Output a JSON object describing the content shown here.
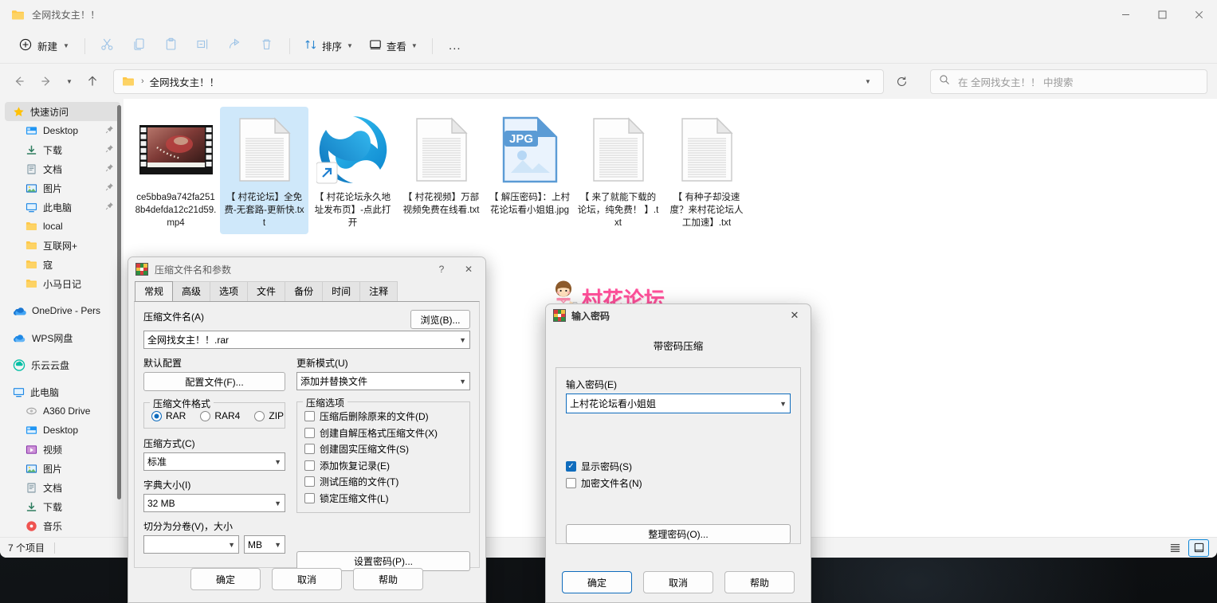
{
  "window": {
    "title": "全网找女主！！",
    "minimize_label": "最小化",
    "maximize_label": "最大化",
    "close_label": "关闭"
  },
  "toolbar": {
    "new_label": "新建",
    "cut_label": "剪切",
    "copy_label": "复制",
    "paste_label": "粘贴",
    "rename_label": "重命名",
    "share_label": "共享",
    "delete_label": "删除",
    "sort_label": "排序",
    "view_label": "查看",
    "more_label": "..."
  },
  "address": {
    "back_label": "后退",
    "forward_label": "前进",
    "recent_label": "最近位置",
    "up_label": "向上",
    "crumb_separator": "›",
    "crumb_text": "全网找女主！！",
    "refresh_label": "刷新"
  },
  "search": {
    "placeholder": "在 全网找女主！！ 中搜索"
  },
  "sidebar": {
    "items": [
      {
        "label": "快速访问",
        "icon": "star-icon",
        "selected": true,
        "indent": false,
        "pinned": false,
        "gap": false
      },
      {
        "label": "Desktop",
        "icon": "desktop-icon",
        "selected": false,
        "indent": true,
        "pinned": true,
        "gap": false
      },
      {
        "label": "下载",
        "icon": "download-icon",
        "selected": false,
        "indent": true,
        "pinned": true,
        "gap": false
      },
      {
        "label": "文档",
        "icon": "document-icon",
        "selected": false,
        "indent": true,
        "pinned": true,
        "gap": false
      },
      {
        "label": "图片",
        "icon": "picture-icon",
        "selected": false,
        "indent": true,
        "pinned": true,
        "gap": false
      },
      {
        "label": "此电脑",
        "icon": "computer-icon",
        "selected": false,
        "indent": true,
        "pinned": true,
        "gap": false
      },
      {
        "label": "local",
        "icon": "folder-icon",
        "selected": false,
        "indent": true,
        "pinned": false,
        "gap": false
      },
      {
        "label": "互联网+",
        "icon": "folder-icon",
        "selected": false,
        "indent": true,
        "pinned": false,
        "gap": false
      },
      {
        "label": "寇",
        "icon": "folder-icon",
        "selected": false,
        "indent": true,
        "pinned": false,
        "gap": false
      },
      {
        "label": "小马日记",
        "icon": "folder-icon",
        "selected": false,
        "indent": true,
        "pinned": false,
        "gap": false
      },
      {
        "label": "OneDrive - Pers",
        "icon": "onedrive-icon",
        "selected": false,
        "indent": false,
        "pinned": false,
        "gap": true
      },
      {
        "label": "WPS网盘",
        "icon": "wps-cloud-icon",
        "selected": false,
        "indent": false,
        "pinned": false,
        "gap": true
      },
      {
        "label": "乐云云盘",
        "icon": "cloud-icon",
        "selected": false,
        "indent": false,
        "pinned": false,
        "gap": true
      },
      {
        "label": "此电脑",
        "icon": "computer-icon",
        "selected": false,
        "indent": false,
        "pinned": false,
        "gap": true
      },
      {
        "label": "A360 Drive",
        "icon": "a360-icon",
        "selected": false,
        "indent": true,
        "pinned": false,
        "gap": false
      },
      {
        "label": "Desktop",
        "icon": "desktop-icon",
        "selected": false,
        "indent": true,
        "pinned": false,
        "gap": false
      },
      {
        "label": "视频",
        "icon": "video-icon",
        "selected": false,
        "indent": true,
        "pinned": false,
        "gap": false
      },
      {
        "label": "图片",
        "icon": "picture-icon",
        "selected": false,
        "indent": true,
        "pinned": false,
        "gap": false
      },
      {
        "label": "文档",
        "icon": "document-icon",
        "selected": false,
        "indent": true,
        "pinned": false,
        "gap": false
      },
      {
        "label": "下载",
        "icon": "download-icon",
        "selected": false,
        "indent": true,
        "pinned": false,
        "gap": false
      },
      {
        "label": "音乐",
        "icon": "music-icon",
        "selected": false,
        "indent": true,
        "pinned": false,
        "gap": false
      }
    ]
  },
  "files": [
    {
      "name": "ce5bba9a742fa2518b4defda12c21d59.mp4",
      "type": "video-thumb",
      "selected": false
    },
    {
      "name": "【 村花论坛】全免费-无套路-更新快.txt",
      "type": "text-file",
      "selected": true
    },
    {
      "name": "【 村花论坛永久地址发布页】-点此打开",
      "type": "edge-shortcut",
      "selected": false
    },
    {
      "name": "【 村花视频】万部视频免费在线看.txt",
      "type": "text-file",
      "selected": false
    },
    {
      "name": "【 解压密码】：上村花论坛看小姐姐.jpg",
      "type": "jpg-file",
      "selected": false
    },
    {
      "name": "【 来了就能下载的论坛，纯免费！ 】.txt",
      "type": "text-file",
      "selected": false
    },
    {
      "name": "【 有种子却没速度？来村花论坛人工加速】.txt",
      "type": "text-file",
      "selected": false
    }
  ],
  "statusbar": {
    "item_count": "7 个项目",
    "list_view_label": "详细列表",
    "large_icons_label": "大图标"
  },
  "watermark": {
    "text": "村花论坛"
  },
  "rar_dialog": {
    "title": "压缩文件名和参数",
    "help_label": "?",
    "close_label": "✕",
    "tabs": [
      {
        "label": "常规",
        "active": true
      },
      {
        "label": "高级",
        "active": false
      },
      {
        "label": "选项",
        "active": false
      },
      {
        "label": "文件",
        "active": false
      },
      {
        "label": "备份",
        "active": false
      },
      {
        "label": "时间",
        "active": false
      },
      {
        "label": "注释",
        "active": false
      }
    ],
    "archive_name_label": "压缩文件名(A)",
    "browse_button": "浏览(B)...",
    "archive_name_value": "全网找女主！！.rar",
    "default_profile_label": "默认配置",
    "profile_button": "配置文件(F)...",
    "update_mode_label": "更新模式(U)",
    "update_mode_value": "添加并替换文件",
    "format_group_label": "压缩文件格式",
    "formats": [
      {
        "label": "RAR",
        "selected": true
      },
      {
        "label": "RAR4",
        "selected": false
      },
      {
        "label": "ZIP",
        "selected": false
      }
    ],
    "method_label": "压缩方式(C)",
    "method_value": "标准",
    "dict_label": "字典大小(I)",
    "dict_value": "32 MB",
    "split_label": "切分为分卷(V)，大小",
    "split_value": "",
    "split_unit": "MB",
    "options_group_label": "压缩选项",
    "options": [
      {
        "label": "压缩后删除原来的文件(D)",
        "checked": false
      },
      {
        "label": "创建自解压格式压缩文件(X)",
        "checked": false
      },
      {
        "label": "创建固实压缩文件(S)",
        "checked": false
      },
      {
        "label": "添加恢复记录(E)",
        "checked": false
      },
      {
        "label": "测试压缩的文件(T)",
        "checked": false
      },
      {
        "label": "锁定压缩文件(L)",
        "checked": false
      }
    ],
    "set_password_button": "设置密码(P)...",
    "ok_button": "确定",
    "cancel_button": "取消",
    "help_button": "帮助"
  },
  "password_dialog": {
    "title": "输入密码",
    "close_label": "✕",
    "heading": "带密码压缩",
    "password_label": "输入密码(E)",
    "password_value": "上村花论坛看小姐姐",
    "show_password_label": "显示密码(S)",
    "show_password_checked": true,
    "encrypt_filenames_label": "加密文件名(N)",
    "encrypt_filenames_checked": false,
    "organize_button": "整理密码(O)...",
    "ok_button": "确定",
    "cancel_button": "取消",
    "help_button": "帮助"
  },
  "colors": {
    "accent": "#0f6cbd",
    "selection": "#cfe8fa",
    "watermark": "#ff4f9a",
    "window_bg": "#f3f3f3"
  }
}
